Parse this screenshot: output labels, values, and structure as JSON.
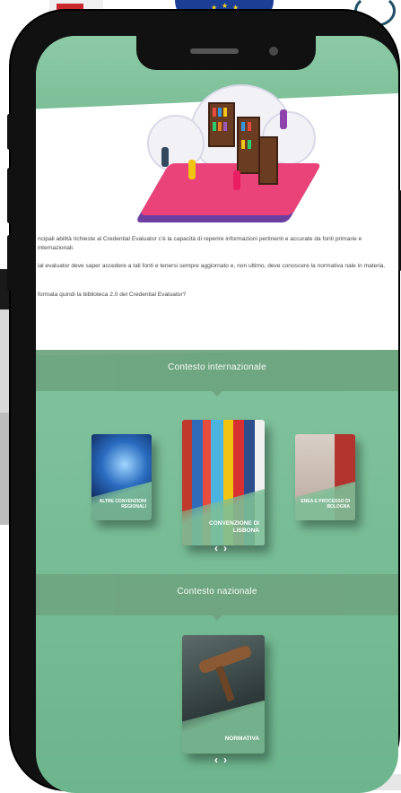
{
  "paragraphs": {
    "p1": "ncipali abilità richieste al Credential Evaluator c'è la capacità di reperire informazioni pertinenti e accurate da fonti primarie e internazionali.",
    "p2": "ial evaluator deve saper accedere a tali fonti e tenersi sempre aggiornato e, non ultimo, deve conoscere la normativa nale in materia.",
    "p3": "formata quindi la biblioteca 2.0 del Credential Evaluator?"
  },
  "sections": {
    "international": {
      "title": "Contesto internazionale",
      "books": {
        "left": "ALTRE CONVENZIONI REGIONALI",
        "center": "CONVENZIONE DI LISBONA",
        "right": "ENEA E PROCESSO DI BOLOGNA"
      },
      "nav": {
        "prev": "‹",
        "next": "›"
      }
    },
    "national": {
      "title": "Contesto nazionale",
      "books": {
        "center": "NORMATIVA"
      },
      "nav": {
        "prev": "‹",
        "next": "›"
      }
    }
  },
  "colors": {
    "accent": "#7fc19c",
    "section_bar": "#6fa581"
  }
}
